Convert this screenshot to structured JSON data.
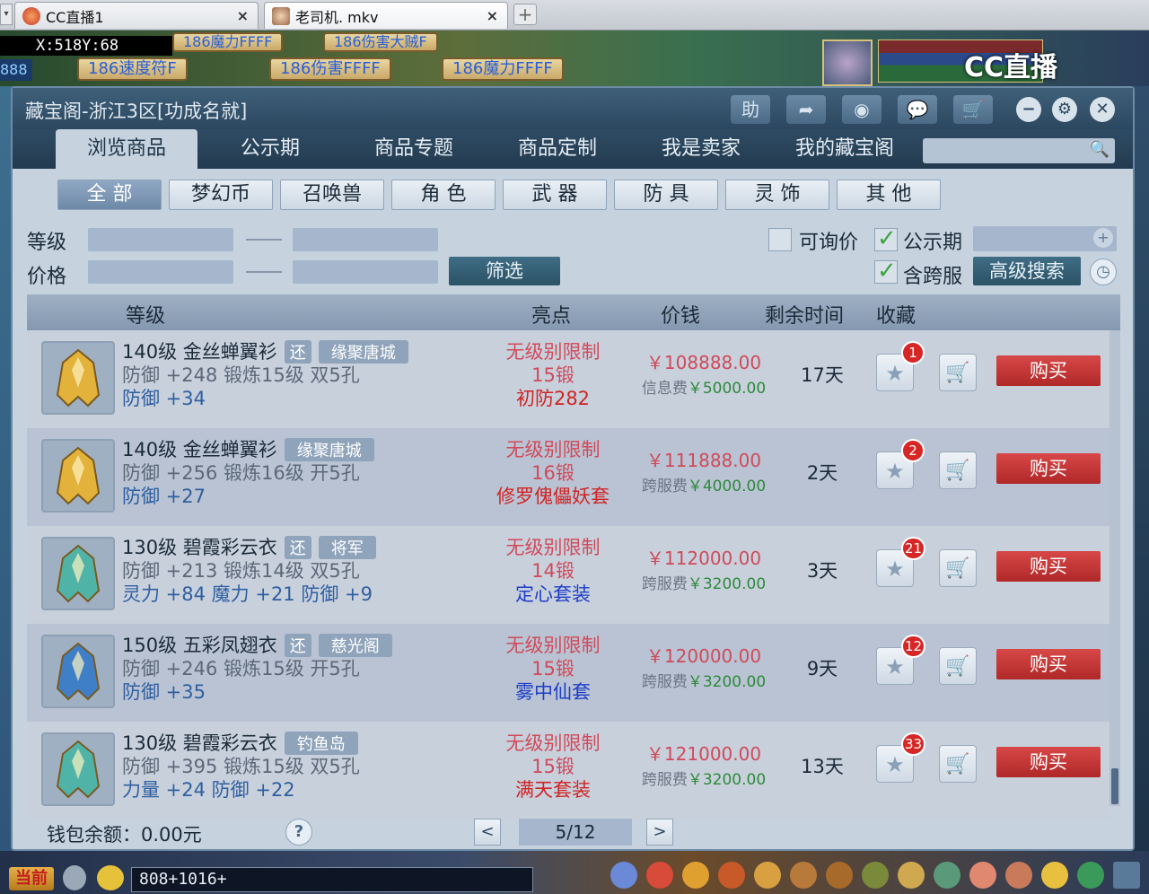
{
  "browser": {
    "tabs": [
      {
        "label": "CC直播1",
        "close": "×"
      },
      {
        "label": "老司机. mkv",
        "close": "×"
      }
    ],
    "add_tab": "+"
  },
  "game_overlay": {
    "coords": "X:518Y:68",
    "stalls_top": [
      "186魔力FFFF",
      "186伤害大贼F"
    ],
    "stalls": [
      "186速度符F",
      "186伤害FFFF",
      "186魔力FFFF"
    ],
    "left_number": "888",
    "logo": "CC直播",
    "chat_channel": "当前",
    "chat_input": "808+1016+"
  },
  "window": {
    "title": "藏宝阁-浙江3区[功成名就]",
    "toolbar": {
      "help": "助",
      "share_icon": "share-icon",
      "record_icon": "record-icon",
      "chat_icon": "chat-icon",
      "cart_icon": "cart-icon"
    },
    "controls": {
      "minimize": "−",
      "settings": "⚙",
      "close": "✕"
    }
  },
  "nav": {
    "tabs": [
      "浏览商品",
      "公示期",
      "商品专题",
      "商品定制",
      "我是卖家",
      "我的藏宝阁"
    ],
    "active_index": 0,
    "search_placeholder": ""
  },
  "categories": {
    "items": [
      "全 部",
      "梦幻币",
      "召唤兽",
      "角 色",
      "武 器",
      "防 具",
      "灵 饰",
      "其 他"
    ],
    "active_index": 0
  },
  "filters": {
    "level_label": "等级",
    "price_label": "价格",
    "filter_button": "筛选",
    "inquiry_label": "可询价",
    "inquiry_checked": false,
    "public_label": "公示期",
    "public_checked": true,
    "cross_label": "含跨服",
    "cross_checked": true,
    "advanced_button": "高级搜索"
  },
  "table": {
    "headers": {
      "level": "等级",
      "highlight": "亮点",
      "price": "价钱",
      "time_left": "剩余时间",
      "favorite": "收藏"
    },
    "rows": [
      {
        "line1": "140级 金丝蝉翼衫",
        "has_huan": true,
        "huan": "还",
        "server": "缘聚唐城",
        "line2": "防御 +248 锻炼15级 双5孔",
        "line3": "防御 +34",
        "hl1": "无级别限制",
        "hl2": "15锻",
        "hl3": "初防282",
        "hl3_color": "#d02424",
        "price": "￥108888.00",
        "fee_label": "信息费",
        "fee_value": "￥5000.00",
        "time_left": "17天",
        "fav_count": "1",
        "buy": "购买",
        "img_color": "#e2b23a"
      },
      {
        "line1": "140级 金丝蝉翼衫",
        "has_huan": false,
        "huan": "",
        "server": "缘聚唐城",
        "line2": "防御 +256 锻炼16级 开5孔",
        "line3": "防御 +27",
        "hl1": "无级别限制",
        "hl2": "16锻",
        "hl3": "修罗傀儡妖套",
        "hl3_color": "#d02424",
        "price": "￥111888.00",
        "fee_label": "跨服费",
        "fee_value": "￥4000.00",
        "time_left": "2天",
        "fav_count": "2",
        "buy": "购买",
        "img_color": "#e2b23a"
      },
      {
        "line1": "130级 碧霞彩云衣",
        "has_huan": true,
        "huan": "还",
        "server": "将军",
        "line2": "防御 +213 锻炼14级 双5孔",
        "line3": "灵力 +84 魔力 +21 防御 +9",
        "hl1": "无级别限制",
        "hl2": "14锻",
        "hl3": "定心套装",
        "hl3_color": "#1f3ec8",
        "price": "￥112000.00",
        "fee_label": "跨服费",
        "fee_value": "￥3200.00",
        "time_left": "3天",
        "fav_count": "21",
        "buy": "购买",
        "img_color": "#4fb3a8"
      },
      {
        "line1": "150级 五彩凤翅衣",
        "has_huan": true,
        "huan": "还",
        "server": "慈光阁",
        "line2": "防御 +246 锻炼15级 开5孔",
        "line3": "防御 +35",
        "hl1": "无级别限制",
        "hl2": "15锻",
        "hl3": "雾中仙套",
        "hl3_color": "#1f3ec8",
        "price": "￥120000.00",
        "fee_label": "跨服费",
        "fee_value": "￥3200.00",
        "time_left": "9天",
        "fav_count": "12",
        "buy": "购买",
        "img_color": "#3e7fc8"
      },
      {
        "line1": "130级 碧霞彩云衣",
        "has_huan": false,
        "huan": "",
        "server": "钓鱼岛",
        "line2": "防御 +395 锻炼15级 双5孔",
        "line3": "力量 +24 防御 +22",
        "hl1": "无级别限制",
        "hl2": "15锻",
        "hl3": "满天套装",
        "hl3_color": "#d02424",
        "price": "￥121000.00",
        "fee_label": "跨服费",
        "fee_value": "￥3200.00",
        "time_left": "13天",
        "fav_count": "33",
        "buy": "购买",
        "img_color": "#4fb3a8"
      }
    ]
  },
  "footer": {
    "wallet": "钱包余额：0.00元",
    "help": "?",
    "prev": "<",
    "next": ">",
    "page": "5/12"
  }
}
